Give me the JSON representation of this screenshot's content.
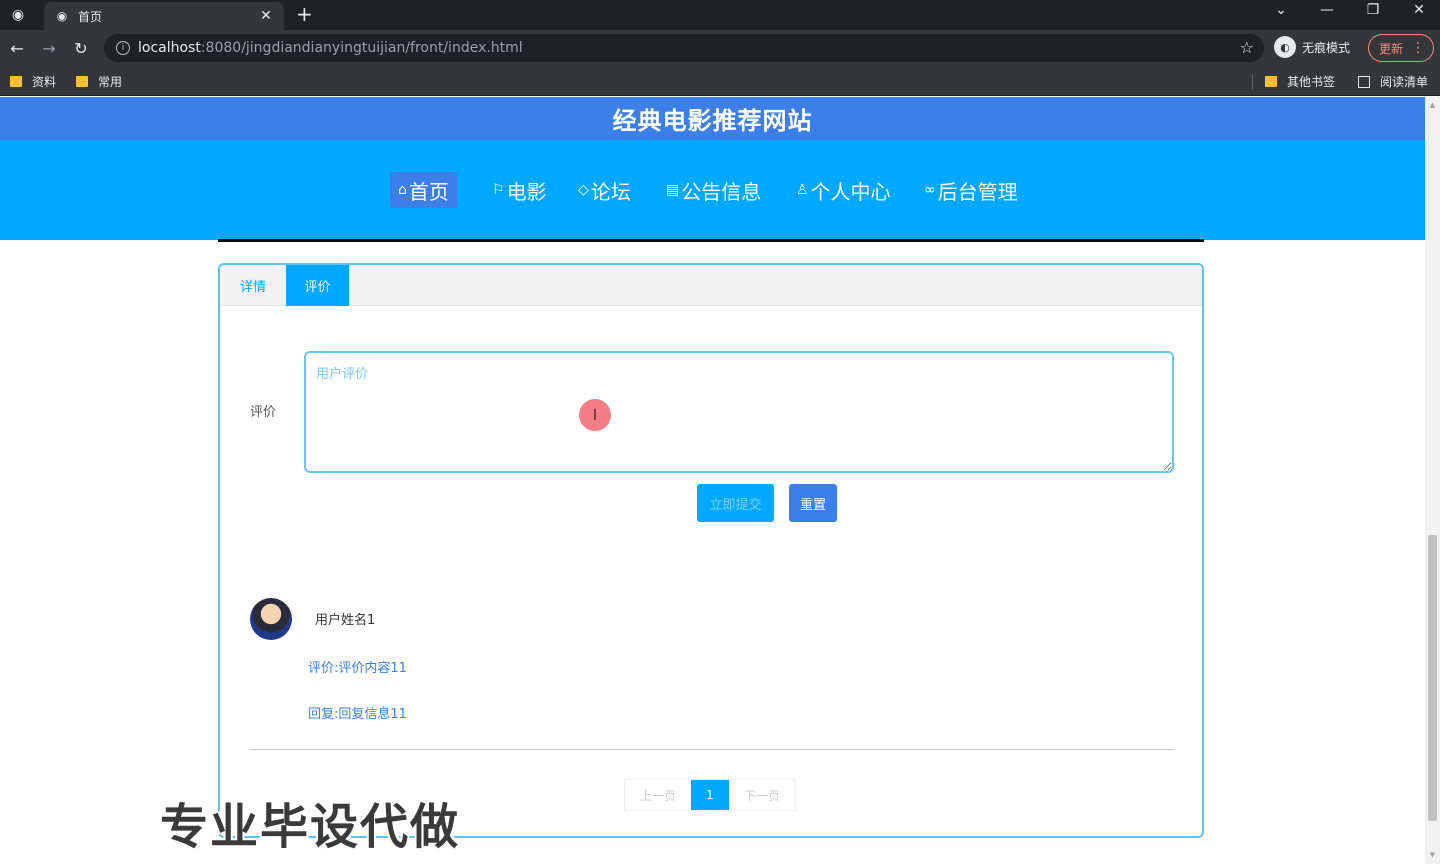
{
  "browser": {
    "tab_title": "首页",
    "url_host": "localhost",
    "url_rest": ":8080/jingdiandianyingtuijian/front/index.html",
    "incognito_label": "无痕模式",
    "update_label": "更新",
    "bookmarks": [
      "资料",
      "常用"
    ],
    "other_bookmarks": "其他书签",
    "reading_list": "阅读清单"
  },
  "site": {
    "title": "经典电影推荐网站",
    "nav": [
      {
        "label": "首页",
        "icon": "home-icon"
      },
      {
        "label": "电影",
        "icon": "flag-icon"
      },
      {
        "label": "论坛",
        "icon": "tag-icon"
      },
      {
        "label": "公告信息",
        "icon": "notice-icon"
      },
      {
        "label": "个人中心",
        "icon": "user-icon"
      },
      {
        "label": "后台管理",
        "icon": "link-icon"
      }
    ]
  },
  "detail": {
    "tabs": [
      "详情",
      "评价"
    ],
    "active_tab": "评价",
    "form_label": "评价",
    "input_placeholder": "用户评价",
    "submit_label": "立即提交",
    "reset_label": "重置"
  },
  "comments": [
    {
      "username": "用户姓名1",
      "review": "评价:评价内容11",
      "reply": "回复:回复信息11"
    }
  ],
  "pagination": {
    "prev": "上一页",
    "current": "1",
    "next": "下一页"
  },
  "watermark": "专业毕设代做",
  "colors": {
    "title_bar": "#3c7fe8",
    "nav_bar": "#00a8ff",
    "accent": "#00a8ff"
  }
}
